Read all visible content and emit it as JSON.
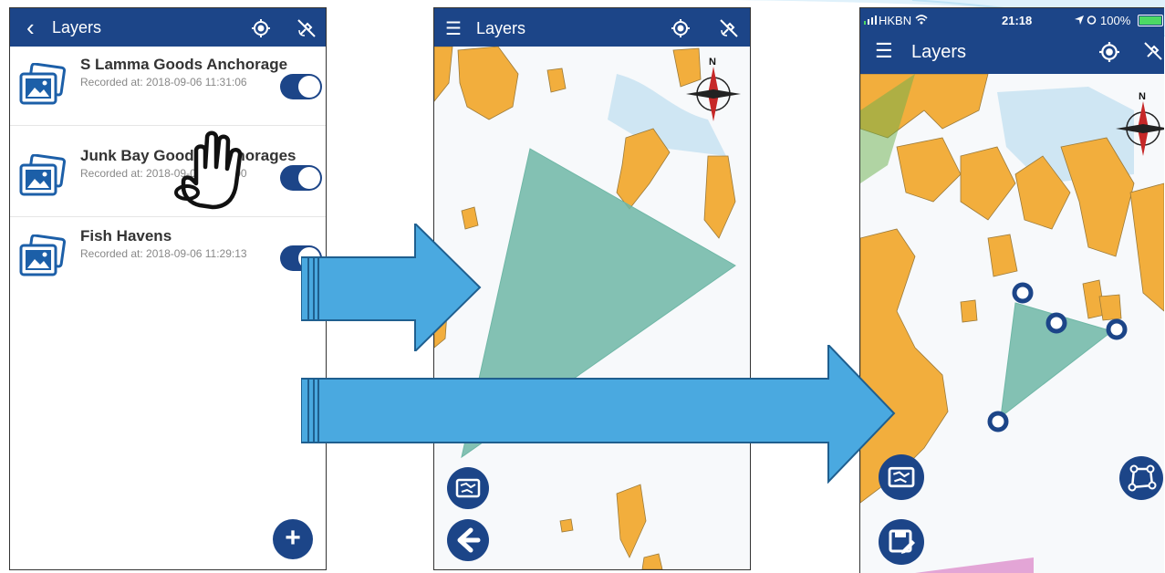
{
  "panel1": {
    "title": "Layers",
    "back_glyph": "‹",
    "items": [
      {
        "title": "S Lamma Goods Anchorage",
        "subtitle": "Recorded at: 2018-09-06 11:31:06"
      },
      {
        "title": "Junk Bay Goods Anchorages",
        "subtitle": "Recorded at: 2018-09-06 11:30:00"
      },
      {
        "title": "Fish Havens",
        "subtitle": "Recorded at: 2018-09-06 11:29:13"
      }
    ],
    "add_glyph": "+"
  },
  "panel2": {
    "title": "Layers",
    "menu_glyph": "☰",
    "compass_label": "N"
  },
  "panel3": {
    "carrier": "HKBN",
    "time": "21:18",
    "battery": "100%",
    "title": "Layers",
    "menu_glyph": "☰",
    "compass_label": "N"
  },
  "colors": {
    "navbar": "#1c4588",
    "land": "#f2ae3d",
    "polygon": "#6fb7a6",
    "arrow": "#4aa9e0",
    "battery": "#4cd964"
  },
  "icons": [
    "back-icon",
    "locate-icon",
    "gps-off-icon",
    "menu-icon",
    "layer-image-icon",
    "add-icon",
    "map-icon",
    "back-arrow-icon",
    "save-icon",
    "polygon-icon",
    "compass-icon",
    "hand-tap-icon"
  ]
}
